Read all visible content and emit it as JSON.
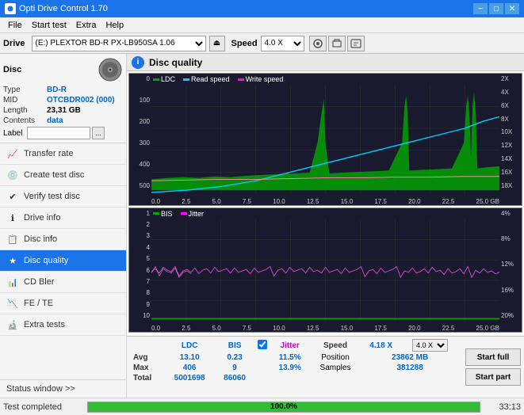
{
  "titlebar": {
    "title": "Opti Drive Control 1.70",
    "minimize_label": "−",
    "maximize_label": "□",
    "close_label": "✕"
  },
  "menubar": {
    "items": [
      "File",
      "Start test",
      "Extra",
      "Help"
    ]
  },
  "drive_toolbar": {
    "drive_label": "Drive",
    "drive_value": "(E:)  PLEXTOR BD-R  PX-LB950SA 1.06",
    "speed_label": "Speed",
    "speed_value": "4.0 X"
  },
  "disc": {
    "title": "Disc",
    "type_label": "Type",
    "type_value": "BD-R",
    "mid_label": "MID",
    "mid_value": "OTCBDR002 (000)",
    "length_label": "Length",
    "length_value": "23,31 GB",
    "contents_label": "Contents",
    "contents_value": "data",
    "label_label": "Label"
  },
  "nav": {
    "items": [
      {
        "id": "transfer-rate",
        "label": "Transfer rate",
        "icon": "📈"
      },
      {
        "id": "create-test-disc",
        "label": "Create test disc",
        "icon": "💿"
      },
      {
        "id": "verify-test-disc",
        "label": "Verify test disc",
        "icon": "✔"
      },
      {
        "id": "drive-info",
        "label": "Drive info",
        "icon": "ℹ"
      },
      {
        "id": "disc-info",
        "label": "Disc info",
        "icon": "📋"
      },
      {
        "id": "disc-quality",
        "label": "Disc quality",
        "icon": "★",
        "active": true
      },
      {
        "id": "cd-bler",
        "label": "CD Bler",
        "icon": "📊"
      },
      {
        "id": "fe-te",
        "label": "FE / TE",
        "icon": "📉"
      },
      {
        "id": "extra-tests",
        "label": "Extra tests",
        "icon": "🔬"
      }
    ],
    "status_window": "Status window >> "
  },
  "disc_quality": {
    "title": "Disc quality",
    "icon_letter": "i",
    "legend": {
      "ldc_label": "LDC",
      "read_speed_label": "Read speed",
      "write_speed_label": "Write speed",
      "bis_label": "BIS",
      "jitter_label": "Jitter"
    }
  },
  "charts": {
    "top": {
      "y_left_labels": [
        "500",
        "400",
        "300",
        "200",
        "100",
        "0"
      ],
      "y_right_labels": [
        "18X",
        "16X",
        "14X",
        "12X",
        "10X",
        "8X",
        "6X",
        "4X",
        "2X"
      ],
      "x_labels": [
        "0.0",
        "2.5",
        "5.0",
        "7.5",
        "10.0",
        "12.5",
        "15.0",
        "17.5",
        "20.0",
        "22.5",
        "25.0 GB"
      ]
    },
    "bottom": {
      "y_left_labels": [
        "10",
        "9",
        "8",
        "7",
        "6",
        "5",
        "4",
        "3",
        "2",
        "1"
      ],
      "y_right_labels": [
        "20%",
        "16%",
        "12%",
        "8%",
        "4%"
      ],
      "x_labels": [
        "0.0",
        "2.5",
        "5.0",
        "7.5",
        "10.0",
        "12.5",
        "15.0",
        "17.5",
        "20.0",
        "22.5",
        "25.0 GB"
      ]
    }
  },
  "stats": {
    "headers": [
      "LDC",
      "BIS"
    ],
    "jitter_checked": true,
    "jitter_label": "Jitter",
    "rows": [
      {
        "label": "Avg",
        "ldc": "13.10",
        "bis": "0.23",
        "jitter": "11.5%"
      },
      {
        "label": "Max",
        "ldc": "406",
        "bis": "9",
        "jitter": "13.9%"
      },
      {
        "label": "Total",
        "ldc": "5001698",
        "bis": "86060",
        "jitter": ""
      }
    ],
    "speed_label": "Speed",
    "speed_value": "4.18 X",
    "speed_select": "4.0 X",
    "position_label": "Position",
    "position_value": "23862 MB",
    "samples_label": "Samples",
    "samples_value": "381288",
    "btn_start_full": "Start full",
    "btn_start_part": "Start part"
  },
  "statusbar": {
    "text": "Test completed",
    "progress_pct": 100,
    "progress_text": "100.0%",
    "time": "33:13"
  }
}
